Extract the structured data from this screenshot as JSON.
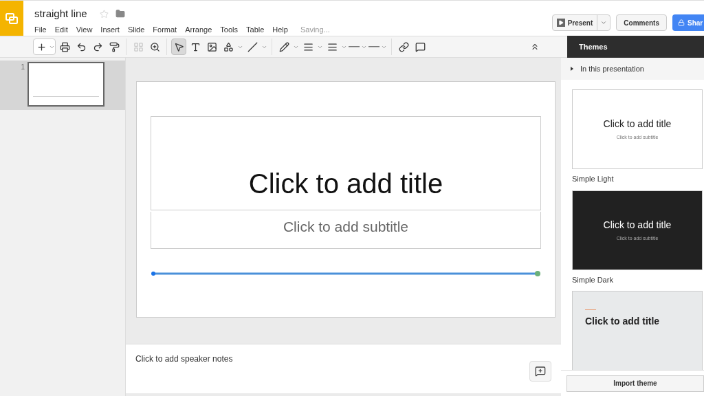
{
  "document": {
    "title": "straight line",
    "starred": false
  },
  "menu": [
    "File",
    "Edit",
    "View",
    "Insert",
    "Slide",
    "Format",
    "Arrange",
    "Tools",
    "Table",
    "Help"
  ],
  "save_status": "Saving...",
  "buttons": {
    "present": "Present",
    "comments": "Comments",
    "share": "Shar"
  },
  "toolbar": {
    "tools": [
      {
        "kind": "pointer",
        "selected": true
      },
      {
        "kind": "textbox",
        "selected": false
      },
      {
        "kind": "image",
        "selected": false
      },
      {
        "kind": "shape",
        "selected": false
      },
      {
        "kind": "line",
        "selected": false
      }
    ]
  },
  "filmstrip": [
    {
      "number": "1",
      "selected": true
    }
  ],
  "slide": {
    "title_placeholder": "Click to add title",
    "subtitle_placeholder": "Click to add subtitle",
    "line_selected": true
  },
  "notes": {
    "placeholder": "Click to add speaker notes"
  },
  "themes_panel": {
    "title": "Themes",
    "section": "In this presentation",
    "import_button": "Import theme",
    "themes": [
      {
        "kind": "light",
        "title": "Click to add title",
        "subtitle": "Click to add subtitle",
        "name": "Simple Light"
      },
      {
        "kind": "dark",
        "title": "Click to add title",
        "subtitle": "Click to add subtitle",
        "name": "Simple Dark"
      },
      {
        "kind": "gray",
        "title": "Click to add title"
      }
    ]
  }
}
